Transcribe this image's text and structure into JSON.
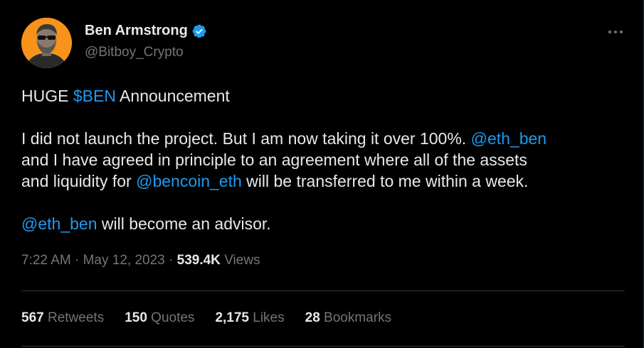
{
  "author": {
    "name": "Ben Armstrong",
    "handle": "@Bitboy_Crypto",
    "verified": true,
    "avatar_icon": "avatar-photo-icon"
  },
  "tweet": {
    "line1_prefix": "HUGE ",
    "line1_cashtag": "$BEN",
    "line1_suffix": " Announcement",
    "p2_text_a": "I did not launch the project. But I am now taking it over 100%. ",
    "p2_mention_a": "@eth_ben",
    "p2_text_b": "and I have agreed in principle to an agreement where all of the assets",
    "p2_text_c": "and liquidity for ",
    "p2_mention_b": "@bencoin_eth",
    "p2_text_d": " will be transferred to me within a week.",
    "p3_mention": "@eth_ben",
    "p3_text": " will become an advisor."
  },
  "meta": {
    "time": "7:22 AM",
    "sep1": " · ",
    "date": "May 12, 2023",
    "sep2": " · ",
    "views_count": "539.4K",
    "views_label": " Views"
  },
  "stats": {
    "retweets_count": "567",
    "retweets_label": " Retweets",
    "quotes_count": "150",
    "quotes_label": " Quotes",
    "likes_count": "2,175",
    "likes_label": " Likes",
    "bookmarks_count": "28",
    "bookmarks_label": " Bookmarks"
  },
  "colors": {
    "background": "#000000",
    "text": "#e7e9ea",
    "secondary": "#71767b",
    "link": "#1d9bf0",
    "divider": "#2f3336",
    "avatar_bg": "#f7931a"
  }
}
